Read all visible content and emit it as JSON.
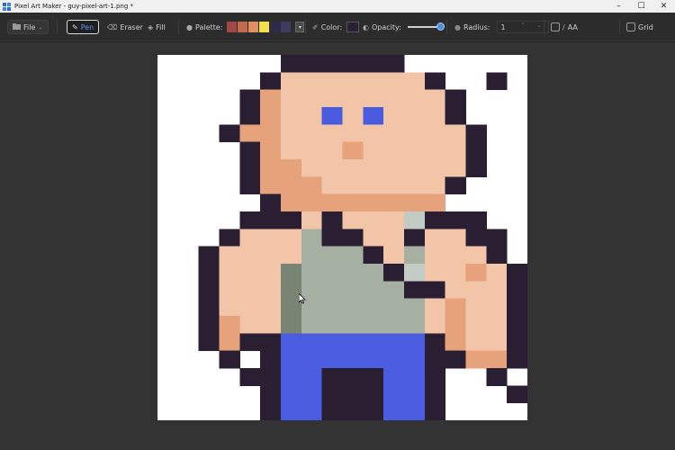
{
  "window": {
    "title": "Pixel Art Maker - guy-pixel-art-1.png *"
  },
  "toolbar": {
    "file_label": "File",
    "pen_label": "Pen",
    "eraser_label": "Eraser",
    "fill_label": "Fill",
    "palette_label": "Palette:",
    "palette_colors": [
      "#a04848",
      "#c06a4e",
      "#e09060",
      "#f0e050",
      "#2e2a4a",
      "#3c3c60"
    ],
    "color_label": "Color:",
    "current_color": "#2a1e33",
    "opacity_label": "Opacity:",
    "opacity_value": 1.0,
    "radius_label": "Radius:",
    "radius_value": "1",
    "aa_label": "AA",
    "aa_checked": false,
    "grid_label": "Grid",
    "grid_checked": false
  },
  "canvas": {
    "legend": {
      "D": "#2a1e33",
      "S": "#f2c4a8",
      "O": "#e6a27a",
      "B": "#4a5be0",
      "G": "#a6b0a2",
      "g": "#7a8474",
      "L": "#c2ccc4",
      "U": "#4a5de0",
      "W": "#ffffff"
    },
    "rows": [
      "WWWWWWDDDDDDWWWWWW",
      "WWWWWDSSSSSSSDWWDW",
      "WWWWDOSSSSSSSSDWWW",
      "WWWWDOSSBSBSSSDWWW",
      "WWWDOOSSSSSSSSSDWW",
      "WWWWDOSSSOSSSSSDWW",
      "WWWWDOOSSSSSSSSDWW",
      "WWWWDOOOSSSSSSDWWW",
      "WWWWWDOOOOOOOOWWWW",
      "WWWWDDDSDSSSLDDDWW",
      "WWWDSSSGDDSSDSSDDW",
      "WWDSSSSGGGDSGSSSDW",
      "WWDSSSgGGGGDLSSOSD",
      "WWDSSSgGGGGGDDSSSD",
      "WWDSSSgGGGGGGSOSSD",
      "WWDOSSgGGGGGGSOSSD",
      "WWDODDUUUUUUUDOSSD",
      "WWWDWDUUUUUUUDDOOD",
      "WWWWDDUUDDDUUDWWDW",
      "WWWWWDUUDDDUUDWWWD",
      "WWWWWDUUDDDUUDWWWW"
    ]
  }
}
